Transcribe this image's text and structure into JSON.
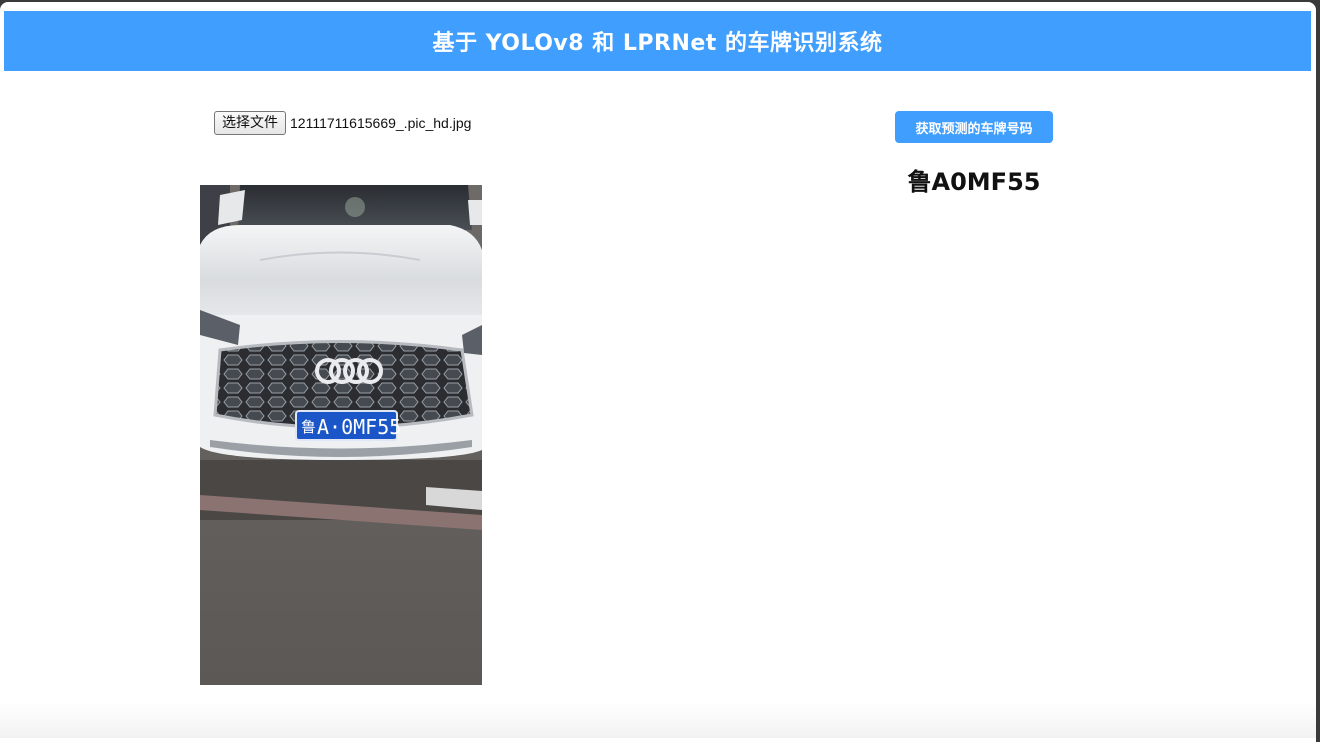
{
  "header": {
    "title": "基于 YOLOv8 和 LPRNet 的车牌识别系统"
  },
  "upload": {
    "button_label": "选择文件",
    "file_name": "12111711615669_.pic_hd.jpg"
  },
  "predict": {
    "button_label": "获取预测的车牌号码",
    "result": "鲁A0MF55"
  },
  "photo": {
    "plate_prefix": "鲁",
    "plate_rest": "A·0MF55"
  },
  "colors": {
    "accent": "#409eff",
    "plate_blue": "#1a56c8"
  }
}
